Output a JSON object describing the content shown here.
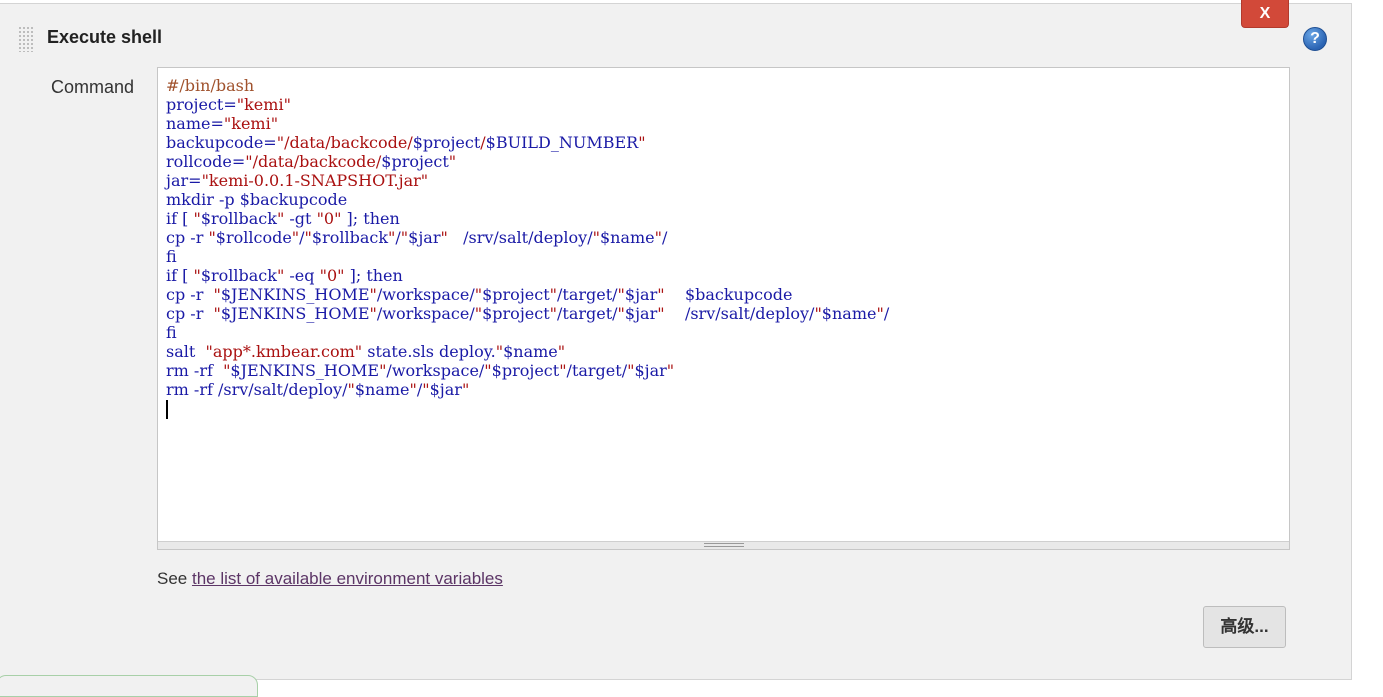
{
  "section": {
    "title": "Execute shell",
    "close_label": "X",
    "help_label": "?"
  },
  "command": {
    "label": "Command",
    "lines": [
      "#/bin/bash",
      "project=\"kemi\"",
      "name=\"kemi\"",
      "backupcode=\"/data/backcode/$project/$BUILD_NUMBER\"",
      "rollcode=\"/data/backcode/$project\"",
      "jar=\"kemi-0.0.1-SNAPSHOT.jar\"",
      "mkdir -p $backupcode",
      "if [ \"$rollback\" -gt \"0\" ]; then",
      "cp -r \"$rollcode\"/\"$rollback\"/\"$jar\"   /srv/salt/deploy/\"$name\"/",
      "fi",
      "if [ \"$rollback\" -eq \"0\" ]; then",
      "cp -r  \"$JENKINS_HOME\"/workspace/\"$project\"/target/\"$jar\"    $backupcode",
      "cp -r  \"$JENKINS_HOME\"/workspace/\"$project\"/target/\"$jar\"    /srv/salt/deploy/\"$name\"/",
      "fi",
      "salt  \"app*.kmbear.com\" state.sls deploy.\"$name\"",
      "rm -rf  \"$JENKINS_HOME\"/workspace/\"$project\"/target/\"$jar\"",
      "rm -rf /srv/salt/deploy/\"$name\"/\"$jar\""
    ]
  },
  "env": {
    "prefix": "See ",
    "link_text": "the list of available environment variables"
  },
  "advanced_button": "高级..."
}
